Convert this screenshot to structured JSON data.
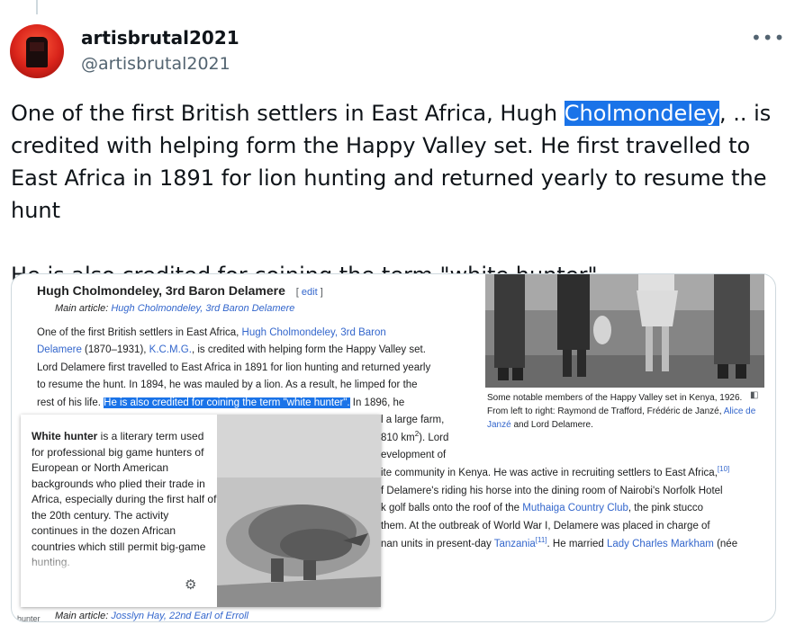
{
  "author": {
    "display_name": "artisbrutal2021",
    "handle": "@artisbrutal2021"
  },
  "tweet": {
    "line1_pre": "One of the first British settlers in East Africa, Hugh ",
    "line1_highlight": "Cholmondeley",
    "line1_post": ", .. is credited with helping form the Happy Valley set. He first travelled to East Africa in 1891 for lion hunting and returned yearly to resume the hunt",
    "line2": "He is also credited for coining the term \"white hunter\"."
  },
  "wiki": {
    "section_title": "Hugh Cholmondeley, 3rd Baron Delamere",
    "edit_label": "edit",
    "main_article_prefix": "Main article:",
    "main_article_link": "Hugh Cholmondeley, 3rd Baron Delamere",
    "para": {
      "l1_pre": "One of the first British settlers in East Africa, ",
      "l1_link": "Hugh Cholmondeley, 3rd Baron",
      "l2_link1": "Delamere",
      "l2_mid": " (1870–1931), ",
      "l2_link2": "K.C.M.G.",
      "l2_post": ", is credited with helping form the Happy Valley set.",
      "l3": "Lord Delamere first travelled to East Africa in 1891 for lion hunting and returned yearly",
      "l4": "to resume the hunt. In 1894, he was mauled by a lion. As a result, he limped for the",
      "l5_pre": "rest of his life. ",
      "l5_sel": "He is also credited for coining the term \"white hunter\".",
      "l5_post": " In 1896, he",
      "l6": "l a large farm,",
      "l7_pre": "810 km",
      "l7_sup": "2",
      "l7_post": "). Lord",
      "l8": "evelopment of",
      "l9": "ite community in Kenya. He was active in recruiting settlers to East Africa,",
      "l9_sup": "[10]",
      "l10": "f Delamere's riding his horse into the dining room of Nairobi's Norfolk Hotel",
      "l11_pre": "k golf balls onto the roof of the ",
      "l11_link": "Muthaiga Country Club",
      "l11_post": ", the pink stucco",
      "l12": "them. At the outbreak of World War I, Delamere was placed in charge of",
      "l13_pre": "nan units in present-day ",
      "l13_link": "Tanzania",
      "l13_post": ". He married ",
      "l13_sup": "[11]",
      "l13_link2": "Lady Charles Markham",
      "l13_end": " (née"
    },
    "photo_caption": {
      "text1": "Some notable members of the Happy Valley set in Kenya, 1926. From left to right: Raymond de Trafford, Frédéric de Janzé, ",
      "link": "Alice de Janzé",
      "text2": " and Lord Delamere."
    },
    "popup": {
      "bold": "White hunter",
      "text": " is a literary term used for professional big game hunters of European or North American backgrounds who plied their trade in Africa, especially during the first half of the 20th century. The activity continues in the dozen African countries which still permit big-game hunting."
    },
    "main_article2_link": "Josslyn Hay, 22nd Earl of Erroll",
    "hunter_label": "hunter"
  },
  "icons": {
    "more": "more-horizontal-icon",
    "gear": "gear-icon",
    "enlarge": "enlarge-icon"
  }
}
